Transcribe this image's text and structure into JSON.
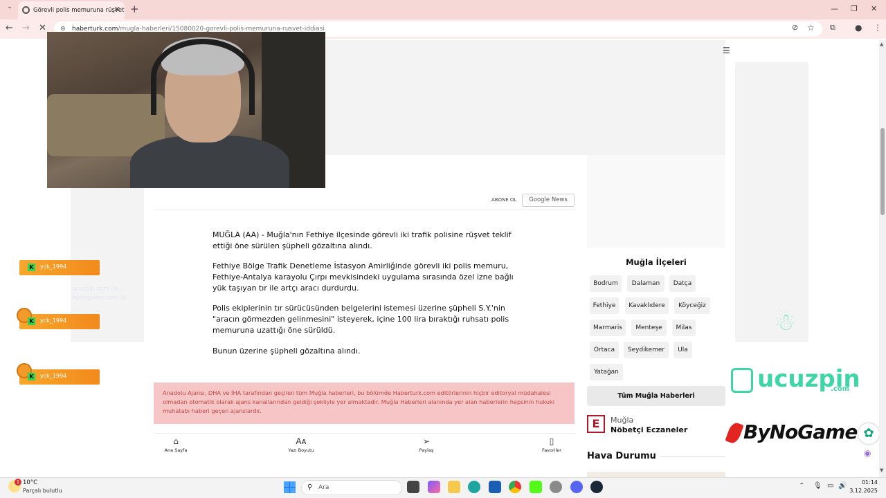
{
  "browser": {
    "tab_title": "Görevli polis memuruna rüşvet",
    "url_host": "haberturk.com",
    "url_path": "/mugla-haberleri/15080020-gorevli-polis-memuruna-rusvet-iddiasi",
    "tab_close": "✕",
    "new_tab": "+"
  },
  "header": {
    "abone": "ABONE OL",
    "google_news": "Google News"
  },
  "article": {
    "p1": "MUĞLA (AA) - Muğla'nın Fethiye ilçesinde görevli iki trafik polisine rüşvet teklif ettiği öne sürülen şüpheli gözaltına alındı.",
    "p2": "Fethiye Bölge Trafik Denetleme İstasyon Amirliğinde görevli iki polis memuru, Fethiye-Antalya karayolu Çırpı mevkisindeki uygulama sırasında özel izne bağlı yük taşıyan tır ile artçı aracı durdurdu.",
    "p3": "Polis ekiplerinin tır sürücüsünden belgelerini istemesi üzerine şüpheli S.Y.'nin \"aracın görmezden gelinmesini\" isteyerek, içine 100 lira bıraktığı ruhsatı polis memuruna uzattığı öne sürüldü.",
    "p4": "Bunun üzerine şüpheli gözaltına alındı.",
    "notice": "Anadolu Ajansı, DHA ve İHA tarafından geçilen tüm Muğla haberleri, bu bölümde Haberturk.com editörlerinin hiçbir editoryal müdahalesi olmadan otomatik olarak ajans kanallarından geldiği şekliyle yer almaktadır. Muğla Haberleri alanında yer alan haberlerin hepsinin hukuki muhatabı haberi geçen ajanslardır."
  },
  "bottom_bar": {
    "home": "Ana Sayfa",
    "font_size": "Yazı Boyutu",
    "share": "Paylaş",
    "favorites": "Favoriler"
  },
  "sidebar": {
    "title": "Muğla İlçeleri",
    "districts": [
      "Bodrum",
      "Dalaman",
      "Datça",
      "Fethiye",
      "Kavaklıdere",
      "Köyceğiz",
      "Marmaris",
      "Menteşe",
      "Milas",
      "Ortaca",
      "Seydikemer",
      "Ula",
      "Yatağan"
    ],
    "all_button": "Tüm Muğla Haberleri",
    "eczane_city": "Muğla",
    "eczane_title": "Nöbetçi Eczaneler",
    "eczane_logo": "E",
    "hava": "Hava Durumu"
  },
  "overlay": {
    "alert_user": "yck_1994",
    "alert_badge": "K",
    "faint_text": "ucuzpin.com ile ...\nbynogame.com ile ...",
    "ucuzpin": "ucuzpin",
    "ucuzpin_com": ".com",
    "bynogame": "ByNoGame"
  },
  "taskbar": {
    "temp": "10°C",
    "condition": "Parçalı bulutlu",
    "weather_badge": "1",
    "search": "Ara",
    "time": "01:14",
    "date": "3.12.2025"
  }
}
